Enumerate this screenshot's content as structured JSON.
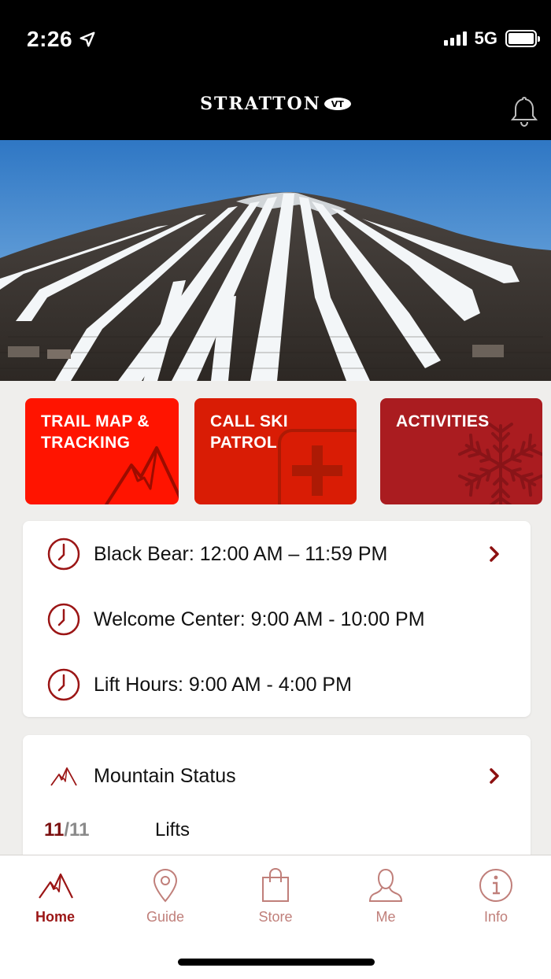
{
  "status_bar": {
    "time": "2:26",
    "network": "5G"
  },
  "header": {
    "brand": "STRATTON",
    "brand_badge": "VT"
  },
  "tiles": [
    {
      "label": "TRAIL MAP &\nTRACKING",
      "color": "#ff1400",
      "icon": "mountain-icon"
    },
    {
      "label": "CALL SKI\nPATROL",
      "color": "#d91c05",
      "icon": "first-aid-cross-icon"
    },
    {
      "label": "ACTIVITIES",
      "color": "#aa1c20",
      "icon": "snowflake-icon"
    }
  ],
  "hours": [
    {
      "text": "Black Bear: 12:00 AM – 11:59 PM",
      "icon": "clock-icon",
      "has_chevron": true
    },
    {
      "text": "Welcome Center:  9:00 AM - 10:00 PM",
      "icon": "clock-icon",
      "has_chevron": false
    },
    {
      "text": "Lift Hours: 9:00 AM - 4:00 PM",
      "icon": "clock-icon",
      "has_chevron": false
    }
  ],
  "mountain_status": {
    "title": "Mountain Status",
    "lifts_open": "11",
    "lifts_total": "/11",
    "lifts_label": "Lifts"
  },
  "nav": [
    {
      "label": "Home",
      "icon": "mountain-icon",
      "active": true
    },
    {
      "label": "Guide",
      "icon": "map-pin-icon",
      "active": false
    },
    {
      "label": "Store",
      "icon": "shopping-bag-icon",
      "active": false
    },
    {
      "label": "Me",
      "icon": "user-icon",
      "active": false
    },
    {
      "label": "Info",
      "icon": "info-icon",
      "active": false
    }
  ],
  "colors": {
    "accent": "#9b1515",
    "nav_inactive": "#c07f7a",
    "header_bg": "#000000",
    "page_bg": "#efeeec"
  }
}
